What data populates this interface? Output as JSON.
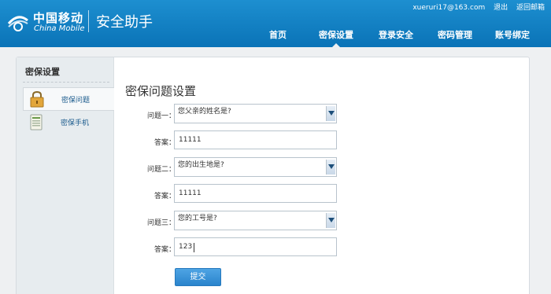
{
  "brand": {
    "logo_cn": "中国移动",
    "logo_en": "China Mobile",
    "app_title": "安全助手"
  },
  "top_links": {
    "user_email": "xueruri17@163.com",
    "logout": "退出",
    "back_mail": "返回邮箱"
  },
  "nav": {
    "items": [
      {
        "label": "首页"
      },
      {
        "label": "密保设置"
      },
      {
        "label": "登录安全"
      },
      {
        "label": "密码管理"
      },
      {
        "label": "账号绑定"
      }
    ],
    "active": "密保设置"
  },
  "sidebar": {
    "title": "密保设置",
    "items": [
      {
        "label": "密保问题",
        "icon": "lock-icon"
      },
      {
        "label": "密保手机",
        "icon": "phone-icon"
      }
    ]
  },
  "form": {
    "title": "密保问题设置",
    "questions": [
      {
        "label": "问题一：",
        "value": "您父亲的姓名是?",
        "answer_label": "答案：",
        "answer": "11111"
      },
      {
        "label": "问题二：",
        "value": "您的出生地是?",
        "answer_label": "答案：",
        "answer": "11111"
      },
      {
        "label": "问题三：",
        "value": "您的工号是?",
        "answer_label": "答案：",
        "answer": "123"
      }
    ],
    "submit_label": "提交"
  },
  "colors": {
    "header_blue": "#0a73b7",
    "accent_link": "#1a5a8c",
    "button_blue": "#2a84cc"
  }
}
